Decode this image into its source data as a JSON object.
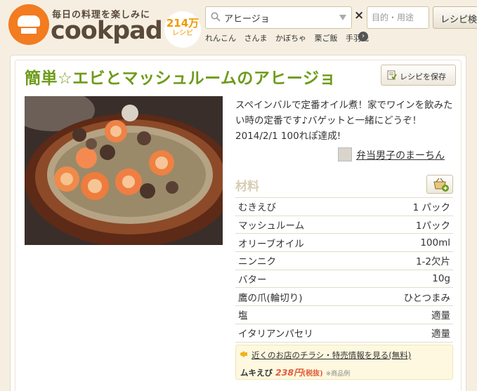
{
  "header": {
    "tagline": "毎日の料理を楽しみに",
    "logo_text": "cookpad",
    "recipe_count": "214万",
    "recipe_count_unit": "レシピ",
    "search_value": "アヒージョ",
    "purpose_placeholder": "目的・用途",
    "search_button": "レシピ検索",
    "keywords": [
      "れんこん",
      "さんま",
      "かぼちゃ",
      "栗ご飯",
      "手羽元"
    ],
    "clear_glyph": "×",
    "more_glyph": "›"
  },
  "recipe": {
    "title": "簡単☆エビとマッシュルームのアヒージョ",
    "save_label": "レシピを保存",
    "description": "スペインバルで定番オイル煮！家でワインを飲みたい時の定番です♪バゲットと一緒にどうぞ！2014/2/1 100れぽ達成!",
    "author": "弁当男子のまーちん"
  },
  "ingredients": {
    "heading": "材料",
    "items": [
      {
        "name": "むきえび",
        "qty": "1 パック"
      },
      {
        "name": "マッシュルーム",
        "qty": "1パック"
      },
      {
        "name": "オリーブオイル",
        "qty": "100ml"
      },
      {
        "name": "ニンニク",
        "qty": "1-2欠片"
      },
      {
        "name": "バター",
        "qty": "10g"
      },
      {
        "name": "鷹の爪(輪切り)",
        "qty": "ひとつまみ"
      },
      {
        "name": "塩",
        "qty": "適量"
      },
      {
        "name": "イタリアンパセリ",
        "qty": "適量"
      }
    ]
  },
  "promo": {
    "link": "近くのお店のチラシ・特売情報を見る(無料)",
    "product": "ムキえび",
    "price": "238円",
    "tax": "(税抜)",
    "note": "※商品例"
  },
  "colors": {
    "brand_orange": "#f37b20",
    "title_green": "#6e9b1a",
    "background": "#f6efe1",
    "price_red": "#e35b3a"
  }
}
